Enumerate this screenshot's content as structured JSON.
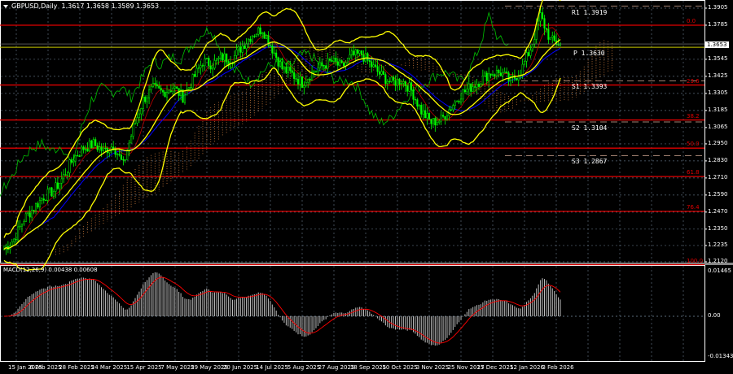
{
  "header": {
    "symbol": "GBPUSD,Daily",
    "open": "1.3617",
    "high": "1.3658",
    "low": "1.3589",
    "close": "1.3653"
  },
  "macd_header": {
    "label": "MACD(12,26,9)",
    "main": "0.00438",
    "signal": "0.00608"
  },
  "price_axis": [
    "1.3905",
    "1.3785",
    "1.3545",
    "1.3425",
    "1.3305",
    "1.3185",
    "1.3065",
    "1.2950",
    "1.2830",
    "1.2710",
    "1.2590",
    "1.2470",
    "1.2350",
    "1.2235",
    "1.2120"
  ],
  "current_price": "1.3653",
  "macd_axis": [
    "0.01465",
    "0.00",
    "-0.01343"
  ],
  "date_axis": [
    "15 Jan 2025",
    "6 Feb 2025",
    "28 Feb 2025",
    "24 Mar 2025",
    "15 Apr 2025",
    "7 May 2025",
    "29 May 2025",
    "20 Jun 2025",
    "14 Jul 2025",
    "5 Aug 2025",
    "27 Aug 2025",
    "18 Sep 2025",
    "10 Oct 2025",
    "3 Nov 2025",
    "25 Nov 2025",
    "17 Dec 2025",
    "12 Jan 2026",
    "3 Feb 2026"
  ],
  "pivots": [
    {
      "label": "R1",
      "value": "1.3919"
    },
    {
      "label": "P",
      "value": "1.3630"
    },
    {
      "label": "S1",
      "value": "1.3393"
    },
    {
      "label": "S2",
      "value": "1.3104"
    },
    {
      "label": "S3",
      "value": "1.2867"
    }
  ],
  "fib_levels": [
    {
      "label": "0.0",
      "price": 1.3785
    },
    {
      "label": "23.6",
      "price": 1.3364
    },
    {
      "label": "38.2",
      "price": 1.3118
    },
    {
      "label": "50.0",
      "price": 1.292
    },
    {
      "label": "61.8",
      "price": 1.272
    },
    {
      "label": "76.4",
      "price": 1.2475
    },
    {
      "label": "100.0",
      "price": 1.21
    }
  ],
  "colors": {
    "bull": "#00ff00",
    "bear": "#00ff00",
    "fib": "#e00000",
    "bands": "#ffff00",
    "kijun": "#0000ff",
    "chikou": "#00c000",
    "cloud": "#c87a3c",
    "macd_signal": "#ff0000",
    "macd_hist": "#c0c0c0",
    "grid": "#5a6a7a"
  },
  "chart_data": {
    "type": "candlestick",
    "symbol": "GBPUSD",
    "timeframe": "Daily",
    "weekly_closes": [
      1.221,
      1.228,
      1.242,
      1.25,
      1.258,
      1.262,
      1.272,
      1.285,
      1.292,
      1.295,
      1.29,
      1.294,
      1.28,
      1.306,
      1.326,
      1.334,
      1.331,
      1.335,
      1.328,
      1.34,
      1.353,
      1.351,
      1.356,
      1.355,
      1.364,
      1.372,
      1.376,
      1.362,
      1.348,
      1.344,
      1.338,
      1.345,
      1.35,
      1.353,
      1.349,
      1.357,
      1.358,
      1.35,
      1.343,
      1.338,
      1.34,
      1.333,
      1.318,
      1.31,
      1.312,
      1.321,
      1.33,
      1.335,
      1.34,
      1.345,
      1.345,
      1.339,
      1.346,
      1.362,
      1.385,
      1.368,
      1.365
    ],
    "ylim": [
      1.211,
      1.3925
    ],
    "macd_ylim": [
      -0.01343,
      0.01465
    ]
  }
}
